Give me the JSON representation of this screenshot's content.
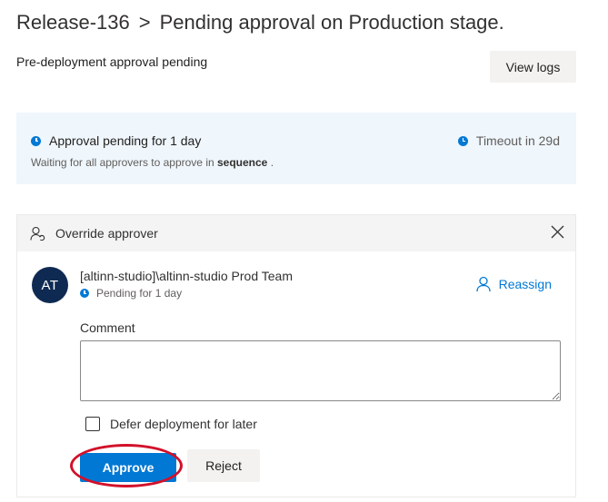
{
  "header": {
    "release": "Release-136",
    "separator": ">",
    "stage_title": "Pending approval on Production stage."
  },
  "subtitle": "Pre-deployment approval pending",
  "toolbar": {
    "view_logs_label": "View logs"
  },
  "status": {
    "main": "Approval pending for 1 day",
    "timeout": "Timeout in 29d",
    "sub_prefix": "Waiting for all approvers to approve in",
    "sub_mode": "sequence",
    "sub_suffix": ".",
    "icon": "clock-icon"
  },
  "override": {
    "label": "Override approver",
    "icon": "override-approver-icon",
    "close_icon": "close-icon"
  },
  "approver": {
    "initials": "AT",
    "name": "[altinn-studio]\\altinn-studio Prod Team",
    "status": "Pending for 1 day",
    "reassign_label": "Reassign"
  },
  "comment": {
    "label": "Comment",
    "value": ""
  },
  "defer": {
    "label": "Defer deployment for later",
    "checked": false
  },
  "actions": {
    "approve_label": "Approve",
    "reject_label": "Reject"
  },
  "colors": {
    "accent": "#0078d4",
    "avatar_bg": "#0f2a52",
    "status_bg": "#eff6fc",
    "highlight": "#d2112a"
  }
}
